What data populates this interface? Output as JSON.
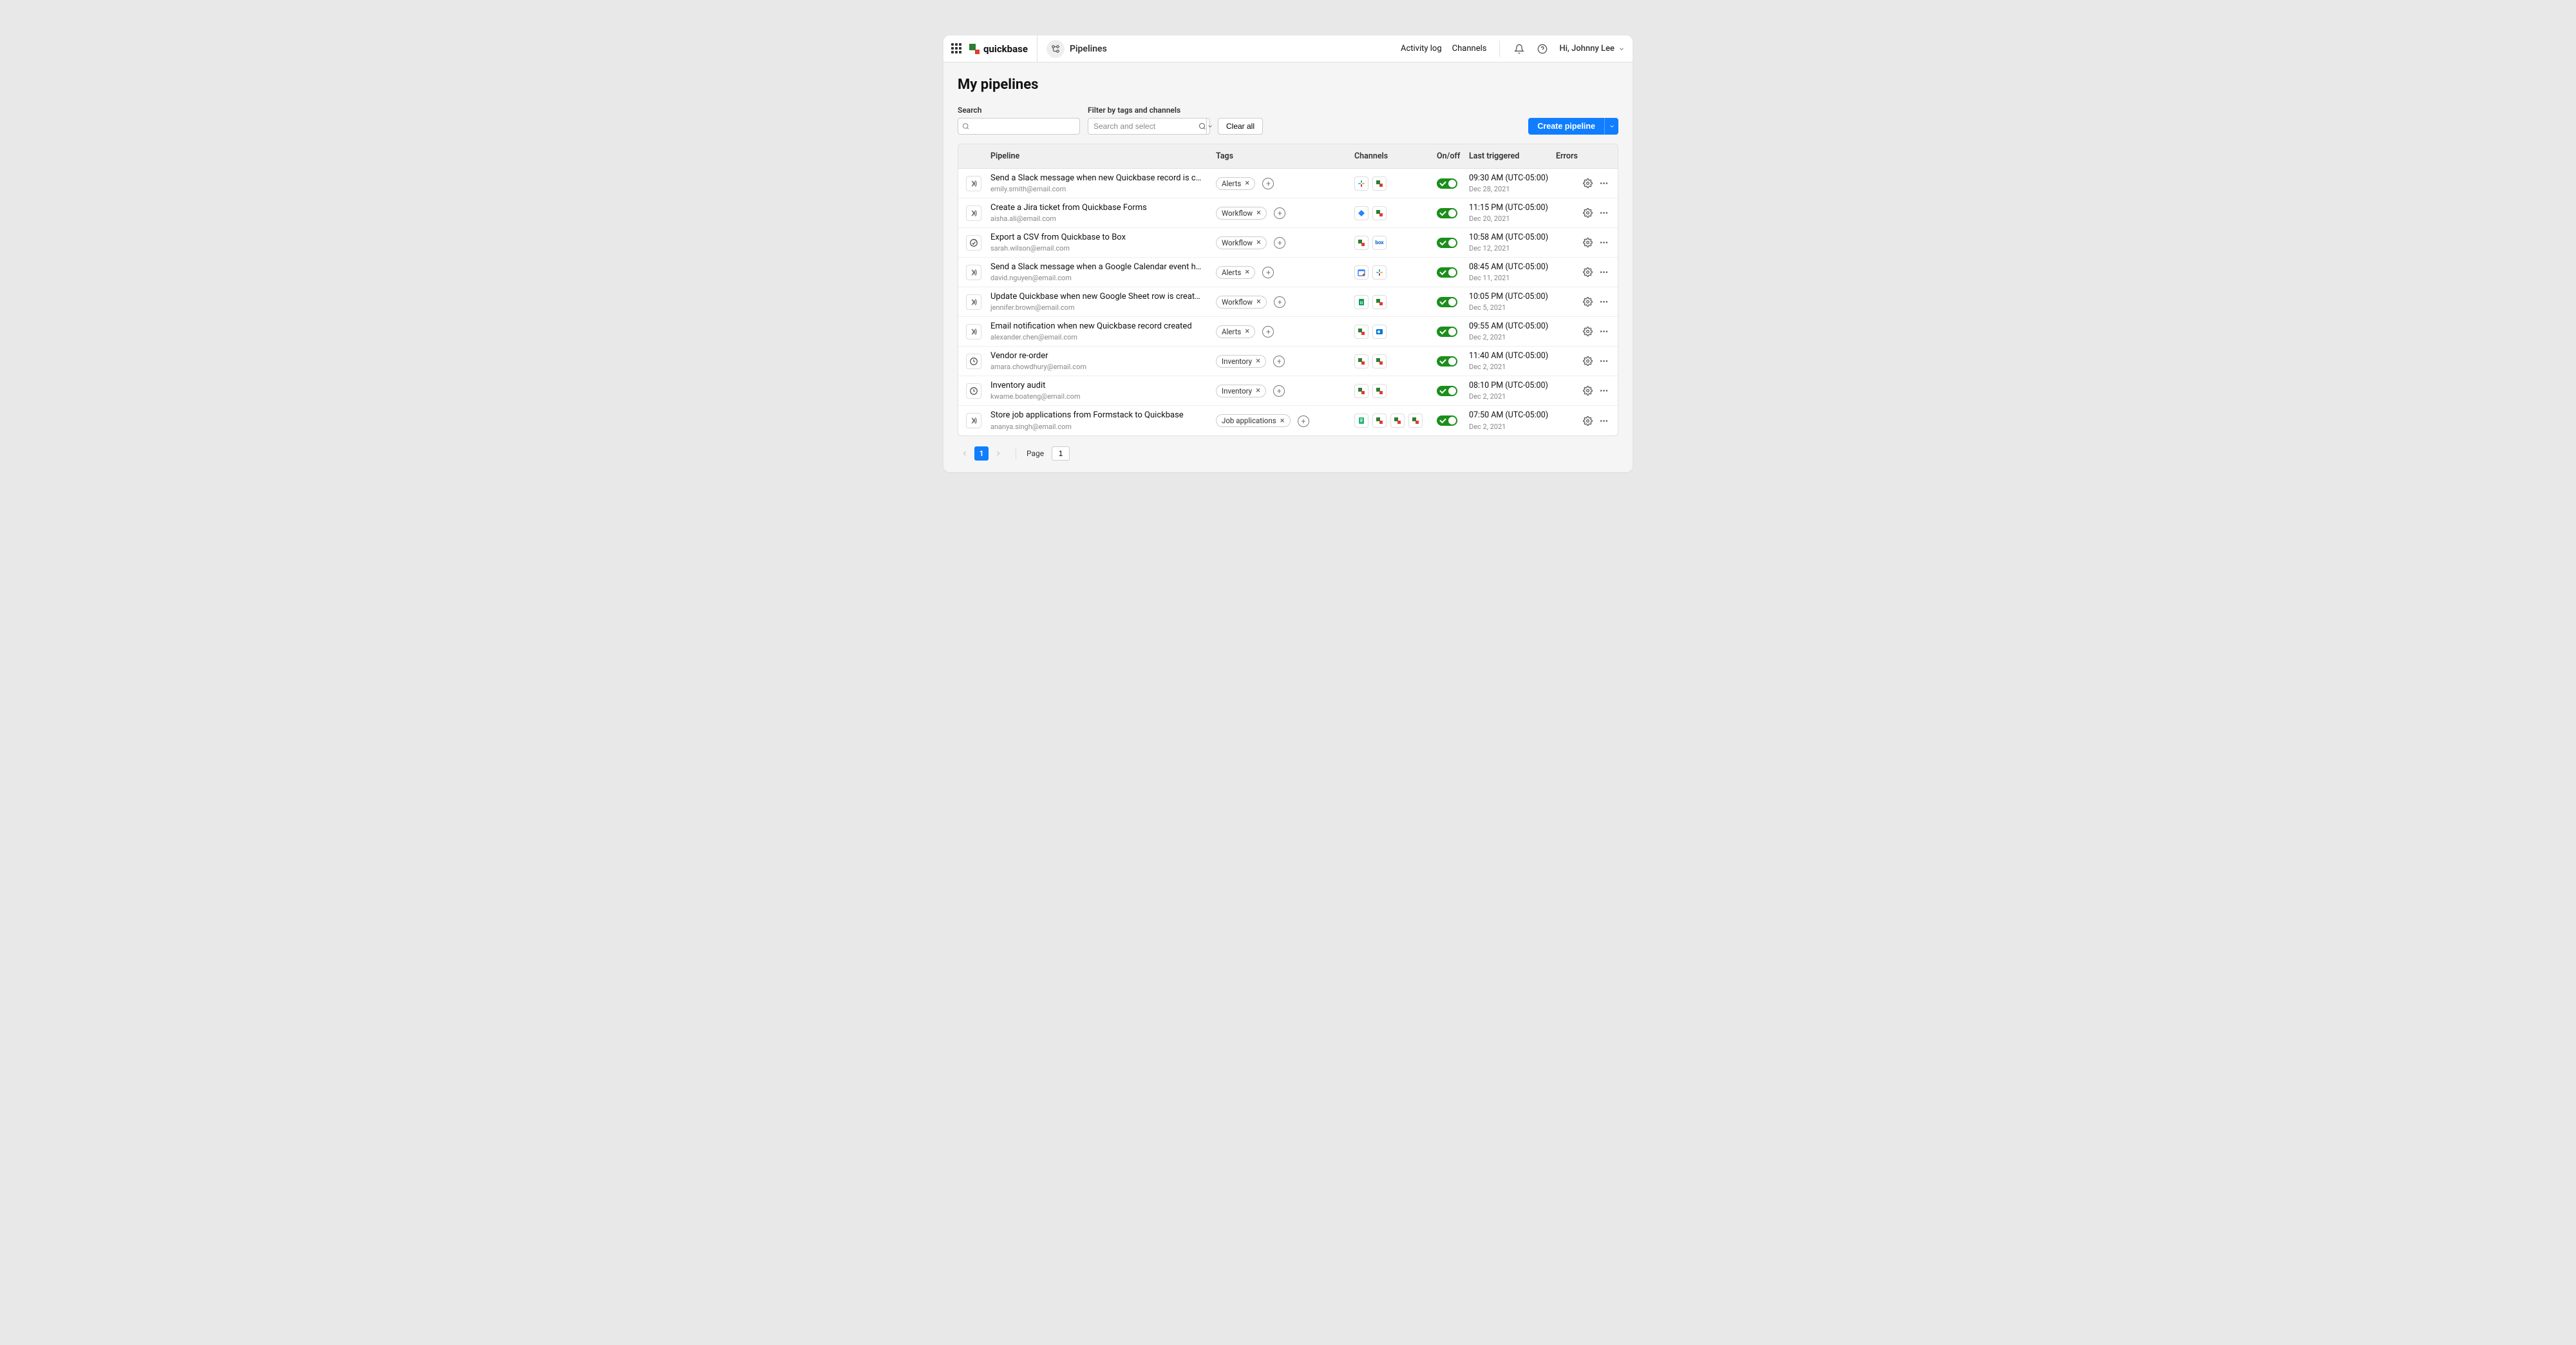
{
  "header": {
    "brand": "quickbase",
    "section": "Pipelines",
    "activity_log": "Activity log",
    "channels": "Channels",
    "user_greeting": "Hi, Johnny Lee"
  },
  "page": {
    "title": "My pipelines",
    "search_label": "Search",
    "filter_label": "Filter by tags and channels",
    "filter_placeholder": "Search and select",
    "clear_all": "Clear all",
    "create_pipeline": "Create pipeline"
  },
  "columns": {
    "pipeline": "Pipeline",
    "tags": "Tags",
    "channels": "Channels",
    "onoff": "On/off",
    "last_triggered": "Last triggered",
    "errors": "Errors"
  },
  "rows": [
    {
      "type": "webhook",
      "name": "Send a Slack message when new Quickbase record is created",
      "owner": "emily.smith@email.com",
      "tag": "Alerts",
      "channels": [
        "slack",
        "quickbase"
      ],
      "time": "09:30 AM (UTC-05:00)",
      "date": "Dec 28, 2021"
    },
    {
      "type": "webhook",
      "name": "Create a Jira ticket from Quickbase Forms",
      "owner": "aisha.ali@email.com",
      "tag": "Workflow",
      "channels": [
        "jira",
        "quickbase"
      ],
      "time": "11:15 PM (UTC-05:00)",
      "date": "Dec 20, 2021"
    },
    {
      "type": "automated",
      "name": "Export a CSV from Quickbase to Box",
      "owner": "sarah.wilson@email.com",
      "tag": "Workflow",
      "channels": [
        "quickbase",
        "box"
      ],
      "time": "10:58 AM (UTC-05:00)",
      "date": "Dec 12, 2021"
    },
    {
      "type": "webhook",
      "name": "Send a Slack message when a Google Calendar event has been creat...",
      "owner": "david.nguyen@email.com",
      "tag": "Alerts",
      "channels": [
        "gcal",
        "slack"
      ],
      "time": "08:45 AM (UTC-05:00)",
      "date": "Dec 11, 2021"
    },
    {
      "type": "webhook",
      "name": "Update Quickbase when new Google Sheet row is created",
      "owner": "jennifer.brown@email.com",
      "tag": "Workflow",
      "channels": [
        "gsheets",
        "quickbase"
      ],
      "time": "10:05 PM (UTC-05:00)",
      "date": "Dec 5, 2021"
    },
    {
      "type": "webhook",
      "name": "Email notification when new Quickbase record created",
      "owner": "alexander.chen@email.com",
      "tag": "Alerts",
      "channels": [
        "quickbase",
        "outlook"
      ],
      "time": "09:55 AM (UTC-05:00)",
      "date": "Dec 2, 2021"
    },
    {
      "type": "scheduled",
      "name": "Vendor re-order",
      "owner": "amara.chowdhury@email.com",
      "tag": "Inventory",
      "channels": [
        "quickbase",
        "quickbase"
      ],
      "time": "11:40 AM (UTC-05:00)",
      "date": "Dec 2, 2021"
    },
    {
      "type": "scheduled",
      "name": "Inventory audit",
      "owner": "kwame.boateng@email.com",
      "tag": "Inventory",
      "channels": [
        "quickbase",
        "quickbase"
      ],
      "time": "08:10 PM (UTC-05:00)",
      "date": "Dec 2, 2021"
    },
    {
      "type": "webhook",
      "name": "Store job applications from Formstack to Quickbase",
      "owner": "ananya.singh@email.com",
      "tag": "Job applications",
      "channels": [
        "formstack",
        "quickbase",
        "quickbase",
        "quickbase"
      ],
      "time": "07:50 AM (UTC-05:00)",
      "date": "Dec 2, 2021"
    }
  ],
  "pagination": {
    "label": "Page",
    "current": "1",
    "input": "1"
  }
}
